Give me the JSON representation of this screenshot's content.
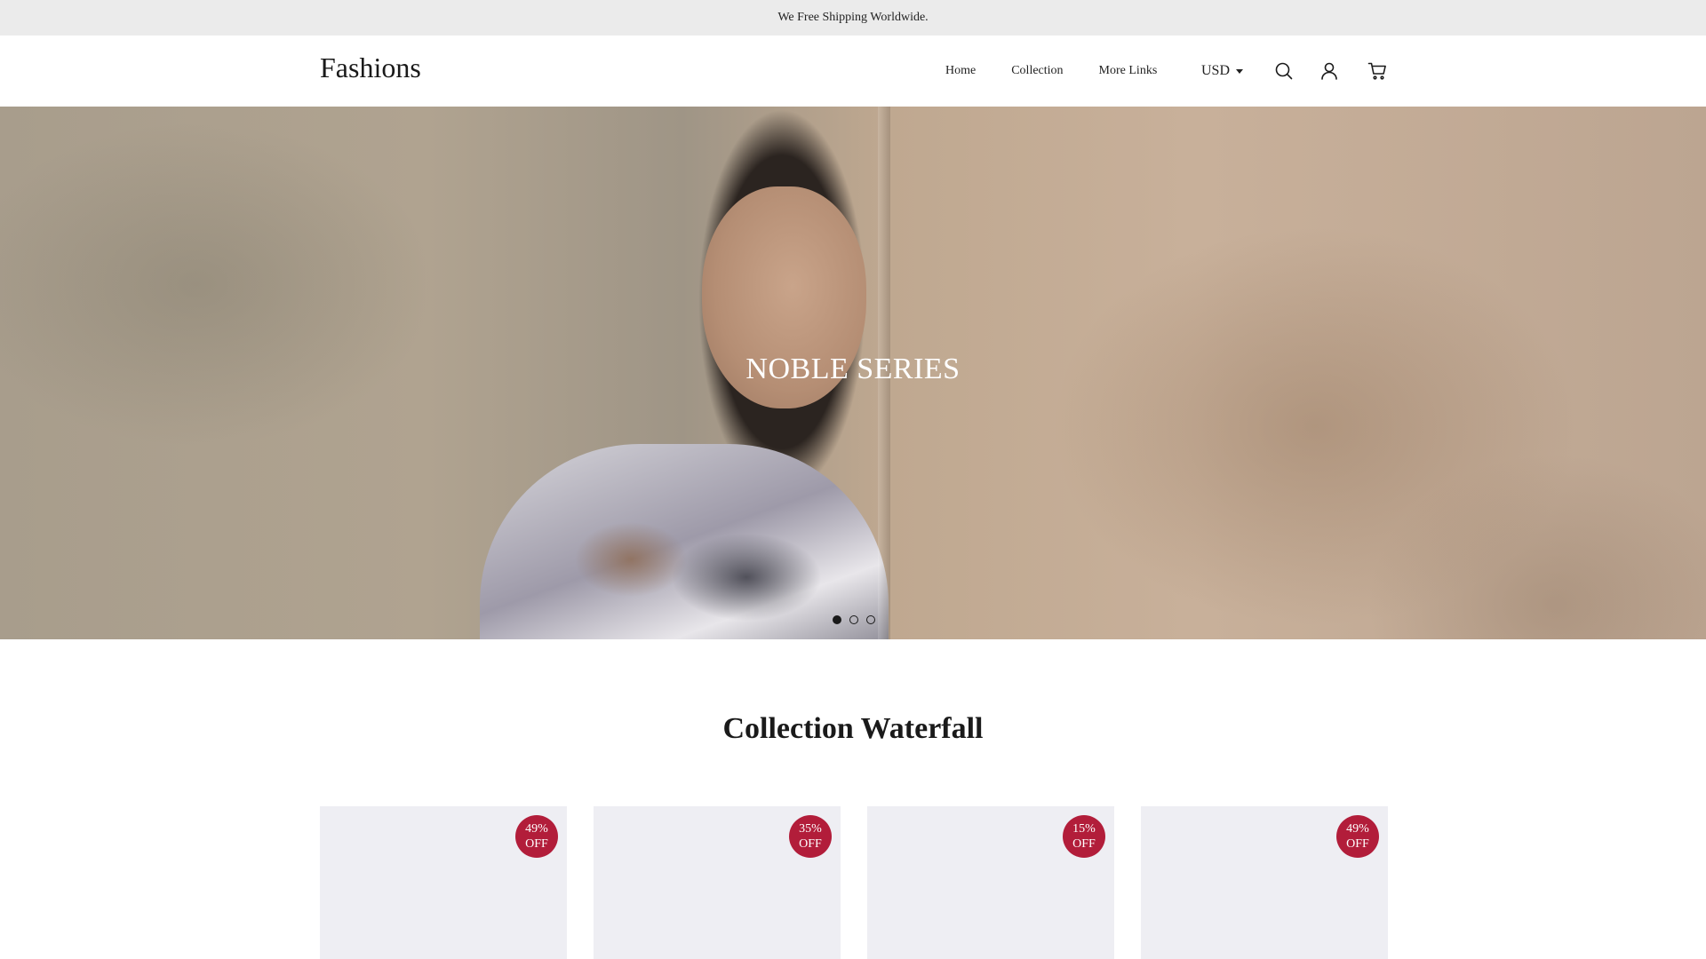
{
  "announcement": {
    "text": "We Free Shipping Worldwide."
  },
  "header": {
    "logo": "Fashions",
    "nav": [
      {
        "label": "Home"
      },
      {
        "label": "Collection"
      },
      {
        "label": "More Links"
      }
    ],
    "currency": "USD",
    "icons": [
      "search-icon",
      "account-icon",
      "cart-icon"
    ]
  },
  "hero": {
    "title": "NOBLE SERIES",
    "slides_total": 3,
    "active_slide": 1
  },
  "collection": {
    "title": "Collection Waterfall",
    "products": [
      {
        "discount": "49%",
        "off_label": "OFF"
      },
      {
        "discount": "35%",
        "off_label": "OFF"
      },
      {
        "discount": "15%",
        "off_label": "OFF"
      },
      {
        "discount": "49%",
        "off_label": "OFF"
      }
    ]
  },
  "colors": {
    "announcement_bg": "#ebebeb",
    "badge": "#b21d3a",
    "card_bg": "#eeeef3",
    "text": "#1a1a1a"
  }
}
